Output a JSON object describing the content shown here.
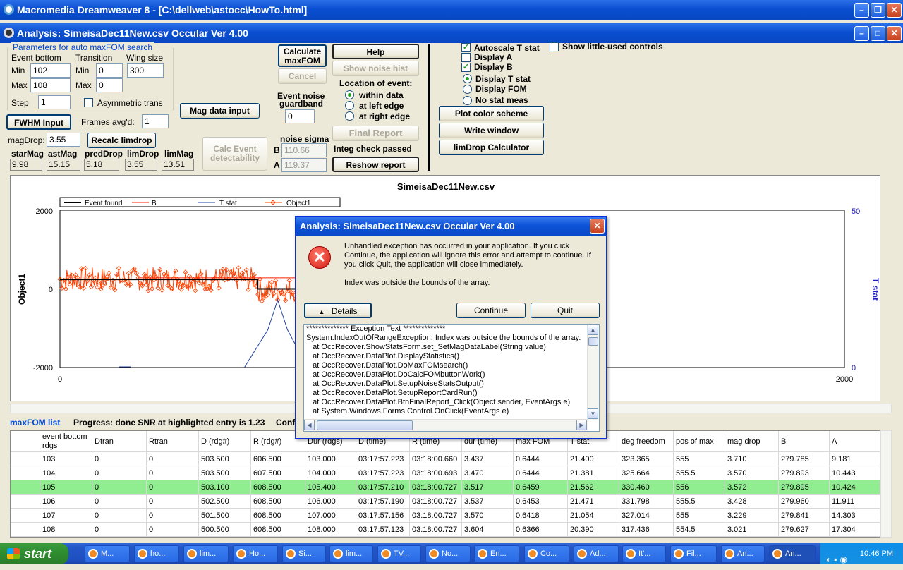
{
  "outer_window": {
    "title": "Macromedia Dreamweaver 8 - [C:\\dellweb\\astocc\\HowTo.html]"
  },
  "app_window": {
    "title": "Analysis: SimeisaDec11New.csv  Occular Ver 4.00"
  },
  "params": {
    "group_title": "Parameters for auto maxFOM search",
    "event_bottom_label": "Event bottom",
    "transition_label": "Transition",
    "wing_size_label": "Wing size",
    "min_label": "Min",
    "max_label": "Max",
    "min_label2": "Min",
    "max_label2": "Max",
    "eb_min": "102",
    "eb_max": "108",
    "tr_min": "0",
    "tr_max": "0",
    "wing_size": "300",
    "step_label": "Step",
    "step": "1",
    "asym_label": "Asymmetric trans"
  },
  "buttons": {
    "calc_maxfom_line1": "Calculate",
    "calc_maxfom_line2": "maxFOM",
    "cancel": "Cancel",
    "help": "Help",
    "show_noise_hist": "Show noise hist",
    "fwhm_input": "FWHM Input",
    "mag_data_input": "Mag data input",
    "recalc_limdrop": "Recalc limdrop",
    "calc_event_line1": "Calc Event",
    "calc_event_line2": "detectability",
    "final_report": "Final Report",
    "reshow_report": "Reshow report",
    "plot_color_scheme": "Plot color scheme",
    "write_window": "Write window",
    "limdrop_calculator": "limDrop Calculator"
  },
  "frames_avg_label": "Frames avg'd:",
  "frames_avg": "1",
  "magdrop_label": "magDrop:",
  "magdrop": "3.55",
  "stats": {
    "labels": [
      "starMag",
      "astMag",
      "predDrop",
      "limDrop",
      "limMag"
    ],
    "values": [
      "9.98",
      "15.15",
      "5.18",
      "3.55",
      "13.51"
    ]
  },
  "noise": {
    "guardband_line1": "Event noise",
    "guardband_line2": "guardband",
    "guardband": "0",
    "sigma_label": "noise sigma",
    "b_label": "B",
    "b": "110.66",
    "a_label": "A",
    "a": "119.37"
  },
  "location": {
    "title": "Location of event:",
    "options": [
      "within data",
      "at left edge",
      "at right edge"
    ]
  },
  "integ_check": "Integ check passed",
  "display": {
    "autoscale": "Autoscale T stat",
    "display_a": "Display A",
    "display_b": "Display B",
    "show_little": "Show little-used controls",
    "radios": [
      "Display T stat",
      "Display FOM",
      "No stat meas"
    ]
  },
  "chart_data": {
    "type": "line",
    "title": "SimeisaDec11New.csv",
    "ylabel": "Object1",
    "y2label": "T stat",
    "xlim": [
      0,
      2000
    ],
    "ylim": [
      -2000,
      2000
    ],
    "y2lim": [
      0,
      50
    ],
    "x_ticks": [
      "0",
      "2000"
    ],
    "y_ticks": [
      "2000",
      "0",
      "-2000"
    ],
    "y2_ticks": [
      "50",
      "0"
    ],
    "legend": [
      "Event found",
      "B",
      "T stat",
      "Object1"
    ],
    "colors": {
      "event": "#000000",
      "b": "#ff2000",
      "tstat": "#2040a0",
      "object1": "#ff4000"
    }
  },
  "maxfom": {
    "label": "maxFOM list",
    "progress": "Progress: done  SNR at highlighted entry is 1.23",
    "trail": "Confi"
  },
  "grid": {
    "headers": [
      "event bottom rdgs",
      "Dtran",
      "Rtran",
      "D (rdg#)",
      "R (rdg#)",
      "Dur (rdgs)",
      "D (time)",
      "R (time)",
      "dur (time)",
      "max FOM",
      "T stat",
      "deg freedom",
      "pos of max",
      "mag drop",
      "B",
      "A"
    ],
    "rows": [
      [
        "103",
        "0",
        "0",
        "503.500",
        "606.500",
        "103.000",
        "03:17:57.223",
        "03:18:00.660",
        "3.437",
        "0.6444",
        "21.400",
        "323.365",
        "555",
        "3.710",
        "279.785",
        "9.181"
      ],
      [
        "104",
        "0",
        "0",
        "503.500",
        "607.500",
        "104.000",
        "03:17:57.223",
        "03:18:00.693",
        "3.470",
        "0.6444",
        "21.381",
        "325.664",
        "555.5",
        "3.570",
        "279.893",
        "10.443"
      ],
      [
        "105",
        "0",
        "0",
        "503.100",
        "608.500",
        "105.400",
        "03:17:57.210",
        "03:18:00.727",
        "3.517",
        "0.6459",
        "21.562",
        "330.460",
        "556",
        "3.572",
        "279.895",
        "10.424"
      ],
      [
        "106",
        "0",
        "0",
        "502.500",
        "608.500",
        "106.000",
        "03:17:57.190",
        "03:18:00.727",
        "3.537",
        "0.6453",
        "21.471",
        "331.798",
        "555.5",
        "3.428",
        "279.960",
        "11.911"
      ],
      [
        "107",
        "0",
        "0",
        "501.500",
        "608.500",
        "107.000",
        "03:17:57.156",
        "03:18:00.727",
        "3.570",
        "0.6418",
        "21.054",
        "327.014",
        "555",
        "3.229",
        "279.841",
        "14.303"
      ],
      [
        "108",
        "0",
        "0",
        "500.500",
        "608.500",
        "108.000",
        "03:17:57.123",
        "03:18:00.727",
        "3.604",
        "0.6366",
        "20.390",
        "317.436",
        "554.5",
        "3.021",
        "279.627",
        "17.304"
      ]
    ]
  },
  "dialog": {
    "title": "Analysis: SimeisaDec11New.csv  Occular Ver 4.00",
    "message": "Unhandled exception has occurred in your application. If you click Continue, the application will ignore this error and attempt to continue. If you click Quit, the application will close immediately.",
    "detail": "Index was outside the bounds of the array.",
    "details_btn": "Details",
    "continue_btn": "Continue",
    "quit_btn": "Quit",
    "exception_lines": [
      "************** Exception Text **************",
      "System.IndexOutOfRangeException: Index was outside the bounds of the array.",
      "   at OccRecover.ShowStatsForm.set_SetMagDataLabel(String value)",
      "   at OccRecover.DataPlot.DisplayStatistics()",
      "   at OccRecover.DataPlot.DoMaxFOMsearch()",
      "   at OccRecover.DataPlot.DoCalcFOMbuttonWork()",
      "   at OccRecover.DataPlot.SetupNoiseStatsOutput()",
      "   at OccRecover.DataPlot.SetupReportCardRun()",
      "   at OccRecover.DataPlot.BtnFinalReport_Click(Object sender, EventArgs e)",
      "   at System.Windows.Forms.Control.OnClick(EventArgs e)"
    ]
  },
  "taskbar": {
    "start": "start",
    "items": [
      "M...",
      "ho...",
      "lim...",
      "Ho...",
      "Si...",
      "lim...",
      "TV...",
      "No...",
      "En...",
      "Co...",
      "Ad...",
      "It'...",
      "Fil...",
      "An...",
      "An..."
    ],
    "clock": "10:46 PM"
  }
}
